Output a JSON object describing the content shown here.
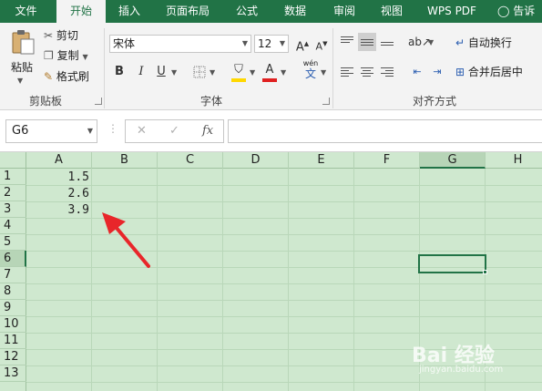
{
  "ribbon_tabs": [
    "文件",
    "开始",
    "插入",
    "页面布局",
    "公式",
    "数据",
    "审阅",
    "视图",
    "WPS PDF",
    "告诉"
  ],
  "active_tab": "开始",
  "clipboard": {
    "paste_label": "粘贴",
    "cut_label": "剪切",
    "copy_label": "复制",
    "format_painter_label": "格式刷",
    "group_label": "剪贴板"
  },
  "font": {
    "font_name": "宋体",
    "font_size": "12",
    "grow_label": "A",
    "shrink_label": "A",
    "bold_label": "B",
    "italic_label": "I",
    "underline_label": "U",
    "font_color_label": "A",
    "phonetic_label": "wén",
    "phonetic_sub": "文",
    "group_label": "字体"
  },
  "alignment": {
    "wrap_text_label": "自动换行",
    "merge_center_label": "合并后居中",
    "group_label": "对齐方式"
  },
  "formula_bar": {
    "name_box": "G6",
    "cancel_symbol": "✕",
    "enter_symbol": "✓",
    "fx_symbol": "fx",
    "formula": ""
  },
  "grid": {
    "columns": [
      "A",
      "B",
      "C",
      "D",
      "E",
      "F",
      "G",
      "H"
    ],
    "rows": [
      "1",
      "2",
      "3",
      "4",
      "5",
      "6",
      "7",
      "8",
      "9",
      "10",
      "11",
      "12",
      "13"
    ],
    "selected_cell": "G6",
    "cells": [
      {
        "ref": "A1",
        "value": "1.5"
      },
      {
        "ref": "A2",
        "value": "2.6"
      },
      {
        "ref": "A3",
        "value": "3.9"
      }
    ]
  },
  "annotation_arrow_color": "#e8262a",
  "watermark": {
    "brand": "Bai 经验",
    "url": "jingyan.baidu.com"
  },
  "colors": {
    "accent": "#217346",
    "grid_bg": "#cfe8cf",
    "highlight_yellow": "#ffd800",
    "font_red": "#e02020"
  }
}
